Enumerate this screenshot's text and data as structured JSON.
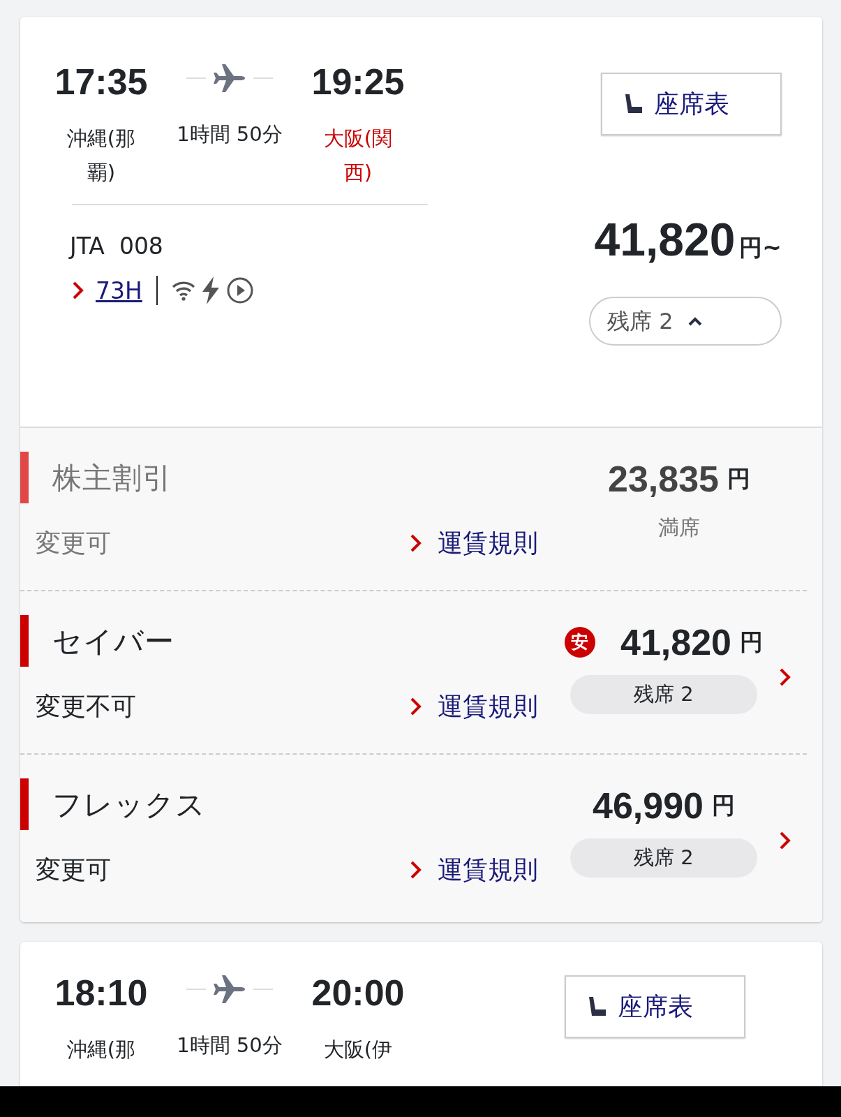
{
  "flights": [
    {
      "departure_time": "17:35",
      "departure_airport": "沖縄(那覇)",
      "duration": "1時間 50分",
      "arrival_time": "19:25",
      "arrival_airport": "大阪(関西)",
      "arrival_highlight": true,
      "seat_map_button": "座席表",
      "flight_number": "JTA  008",
      "aircraft": "73H",
      "lowest_price": "41,820",
      "price_suffix": "円~",
      "seats_toggle": "残席 2",
      "expanded": true,
      "fares": [
        {
          "name": "株主割引",
          "color": "#e04848",
          "change_rule": "変更可",
          "rule_link": "運賃規則",
          "price": "23,835",
          "unit": "円",
          "availability": "満席",
          "sold_out": true
        },
        {
          "name": "セイバー",
          "color": "#cc0000",
          "change_rule": "変更不可",
          "rule_link": "運賃規則",
          "price": "41,820",
          "unit": "円",
          "availability": "残席 2",
          "sold_out": false,
          "badge": "安"
        },
        {
          "name": "フレックス",
          "color": "#cc0000",
          "change_rule": "変更可",
          "rule_link": "運賃規則",
          "price": "46,990",
          "unit": "円",
          "availability": "残席 2",
          "sold_out": false
        }
      ]
    },
    {
      "departure_time": "18:10",
      "departure_airport": "沖縄(那",
      "duration": "1時間 50分",
      "arrival_time": "20:00",
      "arrival_airport": "大阪(伊",
      "arrival_highlight": false,
      "seat_map_button": "座席表"
    }
  ]
}
